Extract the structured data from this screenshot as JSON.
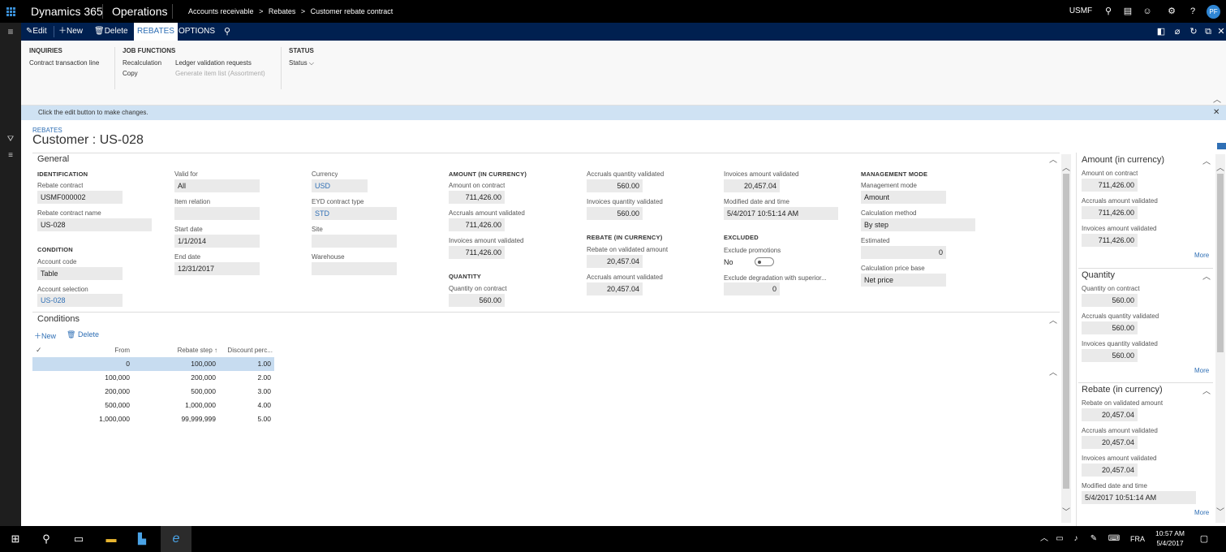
{
  "topbar": {
    "brand1": "Dynamics 365",
    "brand2": "Operations",
    "breadcrumb": [
      "Accounts receivable",
      ">",
      "Rebates",
      ">",
      "Customer rebate contract"
    ],
    "company": "USMF",
    "avatar": "PF"
  },
  "actionbar": {
    "edit": "Edit",
    "new": "New",
    "delete": "Delete",
    "tab_rebates": "REBATES",
    "tab_options": "OPTIONS"
  },
  "ribbon": {
    "inquiries_title": "INQUIRIES",
    "contract_transaction_line": "Contract transaction line",
    "job_functions_title": "JOB FUNCTIONS",
    "recalculation": "Recalculation",
    "ledger_validation_requests": "Ledger validation requests",
    "copy": "Copy",
    "generate_item_list": "Generate item list (Assortment)",
    "status_title": "STATUS",
    "status": "Status"
  },
  "infobar": {
    "message": "Click the edit button to make changes."
  },
  "page": {
    "caption": "REBATES",
    "title": "Customer : US-028"
  },
  "general": {
    "title": "General",
    "identification": "IDENTIFICATION",
    "rebate_contract_label": "Rebate contract",
    "rebate_contract": "USMF000002",
    "rebate_contract_name_label": "Rebate contract name",
    "rebate_contract_name": "US-028",
    "condition": "CONDITION",
    "account_code_label": "Account code",
    "account_code": "Table",
    "account_selection_label": "Account selection",
    "account_selection": "US-028",
    "valid_for_label": "Valid for",
    "valid_for": "All",
    "item_relation_label": "Item relation",
    "item_relation": "",
    "start_date_label": "Start date",
    "start_date": "1/1/2014",
    "end_date_label": "End date",
    "end_date": "12/31/2017",
    "currency_label": "Currency",
    "currency": "USD",
    "eyd_contract_type_label": "EYD contract type",
    "eyd_contract_type": "STD",
    "site_label": "Site",
    "site": "",
    "warehouse_label": "Warehouse",
    "warehouse": "",
    "amount_in_currency": "AMOUNT (IN CURRENCY)",
    "amount_on_contract_label": "Amount on contract",
    "amount_on_contract": "711,426.00",
    "accruals_amount_validated_label": "Accruals amount validated",
    "accruals_amount_validated": "711,426.00",
    "invoices_amount_validated_label": "Invoices amount validated",
    "invoices_amount_validated": "711,426.00",
    "quantity": "QUANTITY",
    "quantity_on_contract_label": "Quantity on contract",
    "quantity_on_contract": "560.00",
    "accruals_quantity_validated_label": "Accruals quantity validated",
    "accruals_quantity_validated": "560.00",
    "invoices_quantity_validated_label": "Invoices quantity validated",
    "invoices_quantity_validated": "560.00",
    "rebate_in_currency": "REBATE (IN CURRENCY)",
    "rebate_on_validated_amount_label": "Rebate on validated amount",
    "rebate_on_validated_amount": "20,457.04",
    "rebate_accruals_amount_validated_label": "Accruals amount validated",
    "rebate_accruals_amount_validated": "20,457.04",
    "rebate_invoices_amount_validated_label": "Invoices amount validated",
    "rebate_invoices_amount_validated": "20,457.04",
    "modified_label": "Modified date and time",
    "modified": "5/4/2017 10:51:14 AM",
    "excluded": "EXCLUDED",
    "exclude_promotions_label": "Exclude promotions",
    "exclude_promotions": "No",
    "exclude_degradation_label": "Exclude degradation with superior...",
    "exclude_degradation": "0",
    "management_mode": "MANAGEMENT MODE",
    "management_mode_label": "Management mode",
    "management_mode_value": "Amount",
    "calculation_method_label": "Calculation method",
    "calculation_method": "By step",
    "estimated_label": "Estimated",
    "estimated": "0",
    "calculation_price_base_label": "Calculation price base",
    "calculation_price_base": "Net price"
  },
  "conditions": {
    "title": "Conditions",
    "new": "New",
    "delete": "Delete",
    "col_from": "From",
    "col_rebate_step": "Rebate step",
    "col_discount": "Discount perc...",
    "rows": [
      {
        "from": "0",
        "step": "100,000",
        "disc": "1.00"
      },
      {
        "from": "100,000",
        "step": "200,000",
        "disc": "2.00"
      },
      {
        "from": "200,000",
        "step": "500,000",
        "disc": "3.00"
      },
      {
        "from": "500,000",
        "step": "1,000,000",
        "disc": "4.00"
      },
      {
        "from": "1,000,000",
        "step": "99,999,999",
        "disc": "5.00"
      }
    ]
  },
  "factbox": {
    "amount_title": "Amount (in currency)",
    "amount_on_contract_label": "Amount on contract",
    "amount_on_contract": "711,426.00",
    "accruals_amount_validated_label": "Accruals amount validated",
    "accruals_amount_validated": "711,426.00",
    "invoices_amount_validated_label": "Invoices amount validated",
    "invoices_amount_validated": "711,426.00",
    "more1": "More",
    "quantity_title": "Quantity",
    "quantity_on_contract_label": "Quantity on contract",
    "quantity_on_contract": "560.00",
    "accruals_quantity_validated_label": "Accruals quantity validated",
    "accruals_quantity_validated": "560.00",
    "invoices_quantity_validated_label": "Invoices quantity validated",
    "invoices_quantity_validated": "560.00",
    "more2": "More",
    "rebate_title": "Rebate (in currency)",
    "rebate_on_validated_amount_label": "Rebate on validated amount",
    "rebate_on_validated_amount": "20,457.04",
    "rebate_accruals_label": "Accruals amount validated",
    "rebate_accruals": "20,457.04",
    "rebate_invoices_label": "Invoices amount validated",
    "rebate_invoices": "20,457.04",
    "modified_label": "Modified date and time",
    "modified": "5/4/2017 10:51:14 AM",
    "more3": "More"
  },
  "taskbar": {
    "lang": "FRA",
    "time": "10:57 AM",
    "date": "5/4/2017"
  },
  "colors": {
    "topbar": "#000000",
    "actionbar": "#002050",
    "accent": "#2f6fb5",
    "selection": "#c7dcf0"
  }
}
